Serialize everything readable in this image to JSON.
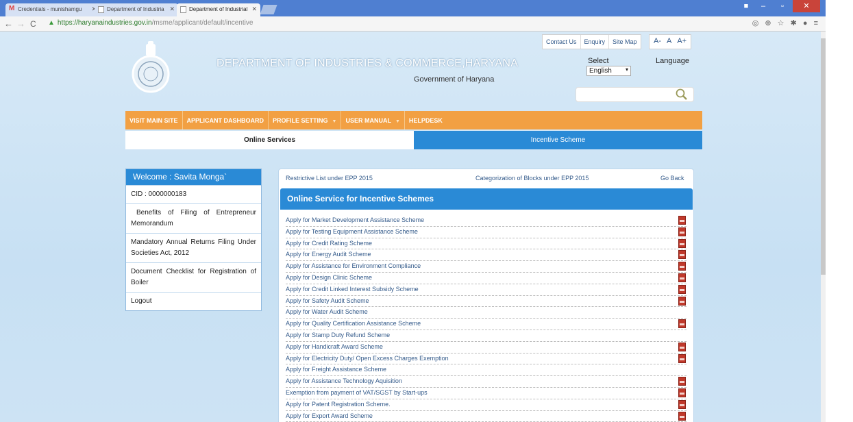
{
  "browser": {
    "tabs": [
      {
        "label": "Credentials - munishamgu",
        "icon": "gmail-icon"
      },
      {
        "label": "Department of Industria",
        "icon": "page-icon"
      },
      {
        "label": "Department of Industrial",
        "icon": "page-icon",
        "active": true
      }
    ],
    "url_host": "https://haryanaindustries.gov.in",
    "url_path": "/msme/applicant/default/incentive"
  },
  "header": {
    "title": "DEPARTMENT OF INDUSTRIES & COMMERCE,HARYANA",
    "subtitle": "Government of Haryana",
    "links": [
      "Contact Us",
      "Enquiry",
      "Site Map"
    ],
    "font_sizes": [
      "A-",
      "A",
      "A+"
    ],
    "select_label": "Select",
    "language_label": "Language",
    "language_value": "English"
  },
  "menu": [
    {
      "label": "VISIT MAIN SITE",
      "caret": false
    },
    {
      "label": "APPLICANT DASHBOARD",
      "caret": false
    },
    {
      "label": "PROFILE SETTING",
      "caret": true
    },
    {
      "label": "USER MANUAL",
      "caret": true
    },
    {
      "label": "HELPDESK",
      "caret": false
    }
  ],
  "service_tabs": {
    "online": "Online Services",
    "incentive": "Incentive Scheme"
  },
  "sidebar": {
    "welcome": "Welcome : Savita Monga`",
    "items": [
      "CID : 0000000183",
      "Benefits of Filing of Entrepreneur Memorandum",
      "Mandatory Annual Returns Filing Under Societies Act, 2012",
      "Document Checklist for Registration of Boiler",
      "Logout"
    ]
  },
  "panel": {
    "link_restrictive": "Restrictive List under EPP 2015",
    "link_categorization": "Categorization of Blocks under EPP 2015",
    "link_back": "Go Back",
    "heading": "Online Service for Incentive Schemes",
    "schemes": [
      {
        "label": "Apply for Market Development Assistance Scheme",
        "pdf": true
      },
      {
        "label": "Apply for Testing Equipment Assistance Scheme",
        "pdf": true
      },
      {
        "label": "Apply for Credit Rating Scheme",
        "pdf": true
      },
      {
        "label": "Apply for Energy Audit Scheme",
        "pdf": true
      },
      {
        "label": "Apply for Assistance for Environment Compliance",
        "pdf": true
      },
      {
        "label": "Apply for Design Clinic Scheme",
        "pdf": true
      },
      {
        "label": "Apply for Credit Linked Interest Subsidy Scheme",
        "pdf": true
      },
      {
        "label": "Apply for Safety Audit Scheme",
        "pdf": true
      },
      {
        "label": "Apply for Water Audit Scheme",
        "pdf": false
      },
      {
        "label": "Apply for Quality Certification Assistance Scheme",
        "pdf": true
      },
      {
        "label": "Apply for Stamp Duty Refund Scheme",
        "pdf": false
      },
      {
        "label": "Apply for Handicraft Award Scheme",
        "pdf": true
      },
      {
        "label": "Apply for Electricity Duty/ Open Excess Charges Exemption",
        "pdf": true
      },
      {
        "label": "Apply for Freight Assistance Scheme",
        "pdf": false
      },
      {
        "label": "Apply for Assistance Technology Aquisition",
        "pdf": true
      },
      {
        "label": "Exemption from payment of VAT/SGST by Start-ups",
        "pdf": true
      },
      {
        "label": "Apply for Patent Registration Scheme.",
        "pdf": true
      },
      {
        "label": "Apply for Export Award Scheme",
        "pdf": true
      }
    ]
  },
  "colors": {
    "menu_orange": "#f2a043",
    "brand_blue": "#2a8ad6",
    "page_bg": "#cde3f4"
  }
}
